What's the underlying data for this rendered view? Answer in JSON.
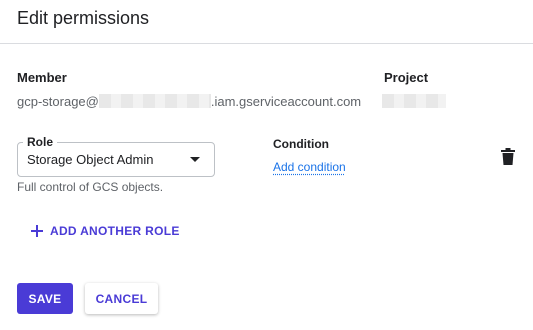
{
  "dialog": {
    "title": "Edit permissions"
  },
  "member": {
    "label": "Member",
    "value_prefix": "gcp-storage@",
    "value_suffix": ".iam.gserviceaccount.com"
  },
  "project": {
    "label": "Project"
  },
  "role": {
    "label": "Role",
    "selected": "Storage Object Admin",
    "hint": "Full control of GCS objects."
  },
  "condition": {
    "label": "Condition",
    "add_link": "Add condition"
  },
  "actions": {
    "add_role": "ADD ANOTHER ROLE",
    "save": "SAVE",
    "cancel": "CANCEL"
  },
  "icons": {
    "delete": "trash-icon",
    "add": "plus-icon",
    "dropdown": "arrow-drop-down-icon"
  },
  "colors": {
    "primary": "#4a3bd6",
    "link": "#1a73e8"
  }
}
